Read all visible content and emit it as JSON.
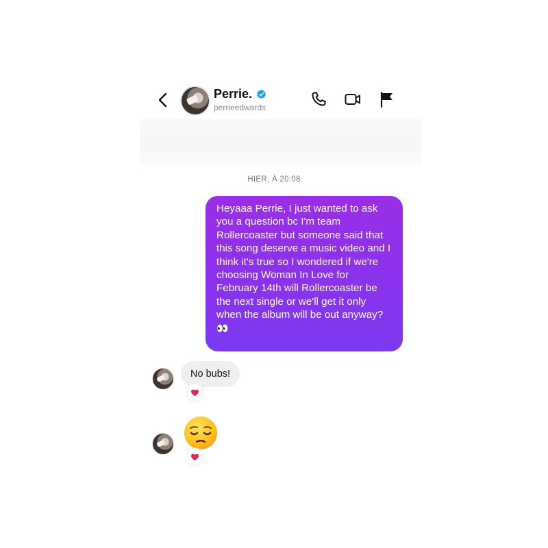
{
  "header": {
    "name": "Perrie.",
    "handle": "perrieedwards",
    "icons": [
      "back-chevron-icon",
      "verified-badge-icon",
      "phone-icon",
      "video-camera-icon",
      "flag-icon"
    ]
  },
  "conversation": {
    "timestamp": "HIER, À 20:08",
    "messages": [
      {
        "from": "me",
        "text": "Heyaaa Perrie, I just wanted to ask you a question bc I'm team Rollercoaster but someone said that this song deserve a music video and I think it's true so I wondered if we're choosing Woman In Love for February 14th will Rollercoaster be the next single or we'll get it only when the album will be out anyway?",
        "emoji": "👀"
      },
      {
        "from": "perrie",
        "text": "No bubs!",
        "reaction": "red-heart-icon"
      },
      {
        "from": "perrie",
        "emoji_name": "pensive-face-emoji",
        "reaction": "red-heart-icon"
      }
    ]
  },
  "colors": {
    "sent_bubble_top": "#9a2ee6",
    "sent_bubble_bottom": "#7b3af0",
    "received_bubble": "#efefef",
    "verified_blue": "#1d9bf0",
    "heart_red": "#e0245e"
  }
}
